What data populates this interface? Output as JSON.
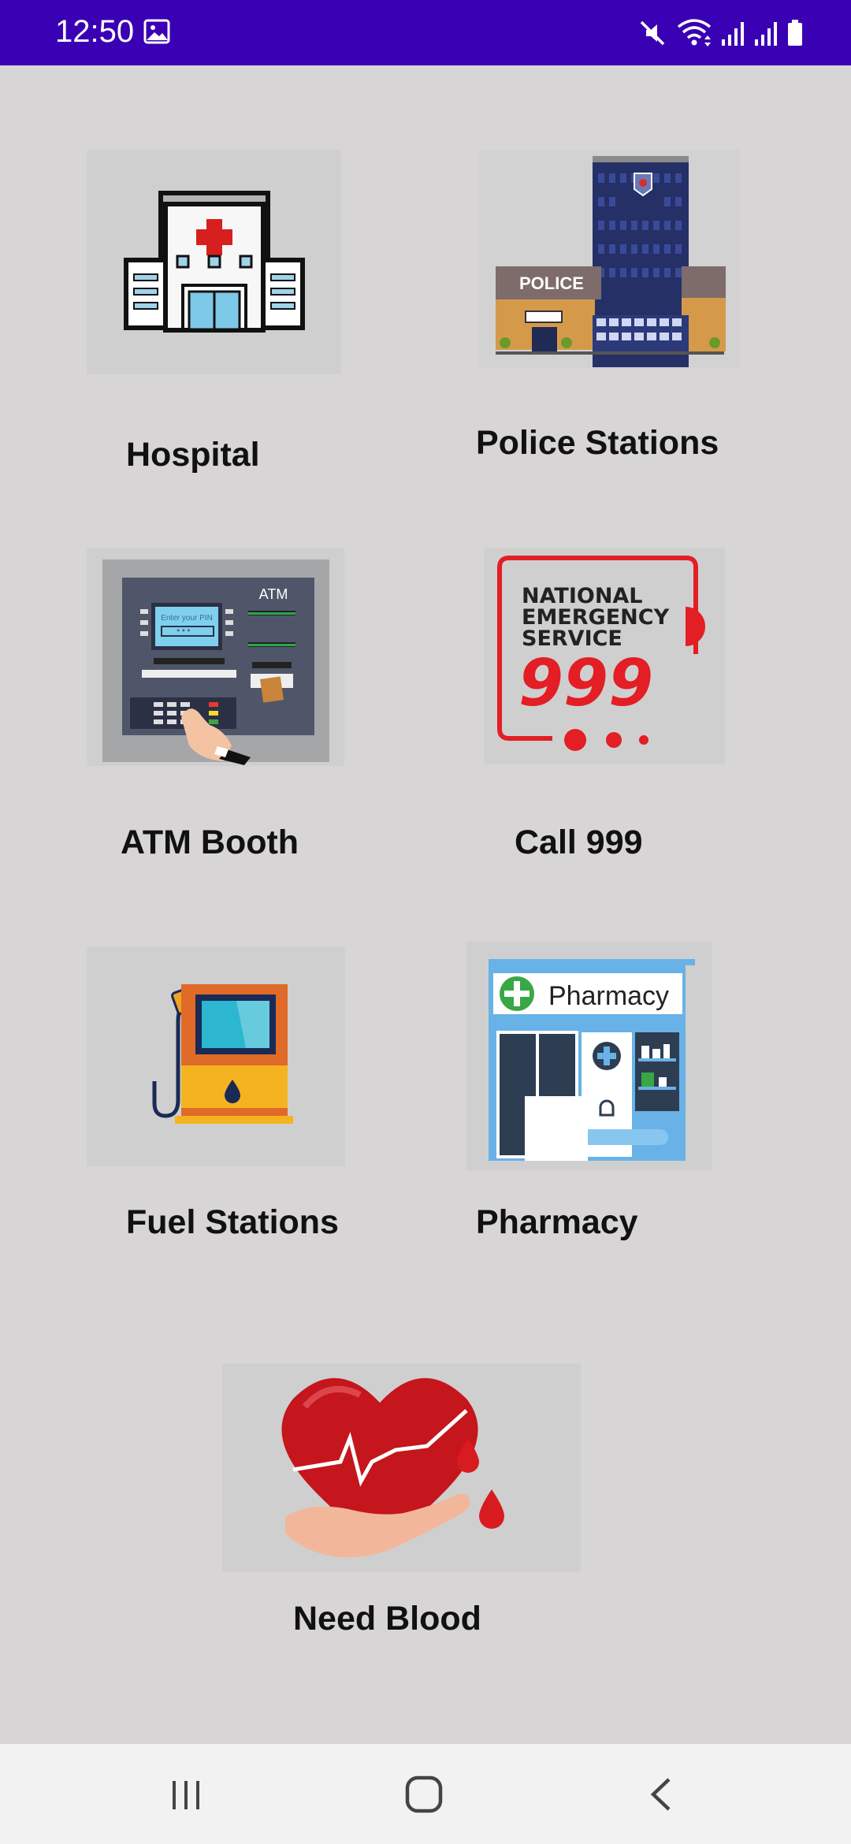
{
  "status_bar": {
    "time": "12:50",
    "icons": [
      "gallery-icon",
      "mute-icon",
      "wifi-icon",
      "signal-icon",
      "signal-icon",
      "battery-icon"
    ]
  },
  "services": [
    {
      "label": "Hospital",
      "icon": "hospital-building-icon"
    },
    {
      "label": "Police Stations",
      "icon": "police-station-icon",
      "sign_text": "POLICE"
    },
    {
      "label": "ATM Booth",
      "icon": "atm-machine-icon",
      "sign_text": "ATM",
      "screen_text": "Enter your PIN",
      "pin_mask": "* * * _"
    },
    {
      "label": "Call 999",
      "icon": "emergency-999-icon",
      "sign_lines": [
        "NATIONAL",
        "EMERGENCY",
        "SERVICE"
      ],
      "number": "999"
    },
    {
      "label": "Fuel Stations",
      "icon": "fuel-pump-icon"
    },
    {
      "label": "Pharmacy",
      "icon": "pharmacy-store-icon",
      "sign_text": "Pharmacy"
    },
    {
      "label": "Need Blood",
      "icon": "blood-donation-icon"
    }
  ],
  "nav_bar": {
    "buttons": [
      "recent-apps-icon",
      "home-icon",
      "back-icon"
    ]
  },
  "colors": {
    "status_bar": "#3a00b4",
    "background": "#d7d5d6",
    "nav_bar": "#f2f2f2",
    "emergency_red": "#e31e24"
  }
}
